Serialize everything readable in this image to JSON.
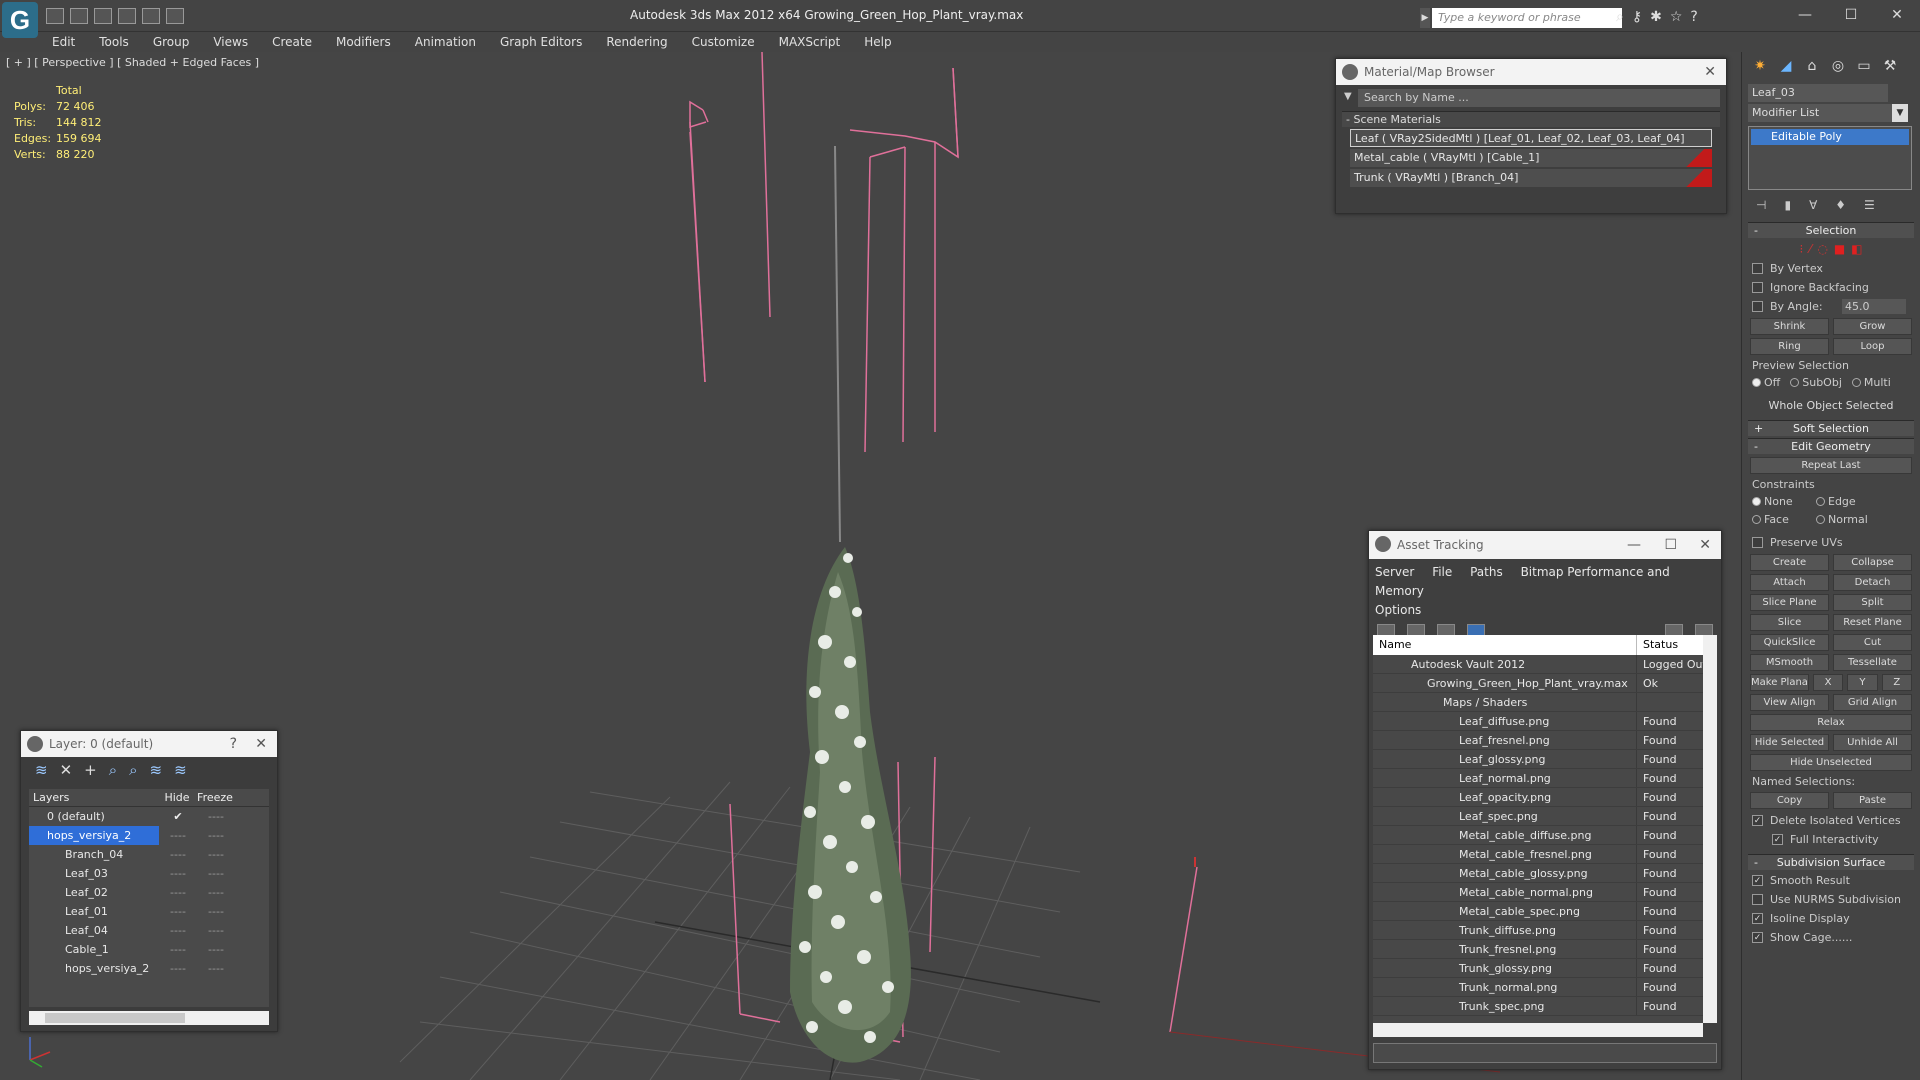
{
  "title_bar": {
    "window_title": "Autodesk 3ds Max  2012 x64       Growing_Green_Hop_Plant_vray.max",
    "search_placeholder": "Type a keyword or phrase",
    "minimize": "—",
    "maximize": "☐",
    "close": "✕"
  },
  "menu": [
    "Edit",
    "Tools",
    "Group",
    "Views",
    "Create",
    "Modifiers",
    "Animation",
    "Graph Editors",
    "Rendering",
    "Customize",
    "MAXScript",
    "Help"
  ],
  "viewport": {
    "label": "[ + ] [ Perspective ] [ Shaded + Edged Faces ]",
    "stats": {
      "header": "Total",
      "rows": [
        {
          "k": "Polys:",
          "v": "72 406"
        },
        {
          "k": "Tris:",
          "v": "144 812"
        },
        {
          "k": "Edges:",
          "v": "159 694"
        },
        {
          "k": "Verts:",
          "v": "88 220"
        }
      ]
    }
  },
  "material_browser": {
    "title": "Material/Map Browser",
    "search_placeholder": "Search by Name ...",
    "group": "- Scene Materials",
    "materials": [
      "Leaf  ( VRay2SidedMtl )  [Leaf_01, Leaf_02, Leaf_03, Leaf_04]",
      "Metal_cable  ( VRayMtl )  [Cable_1]",
      "Trunk  ( VRayMtl )  [Branch_04]"
    ]
  },
  "layers": {
    "title": "Layer: 0 (default)",
    "help": "?",
    "col_layers": "Layers",
    "col_hide": "Hide",
    "col_freeze": "Freeze",
    "rows": [
      {
        "name": "0 (default)",
        "hide": "✔",
        "freeze": "----"
      },
      {
        "name": "hops_versiya_2",
        "hide": "----",
        "freeze": "----"
      },
      {
        "name": "Branch_04",
        "hide": "----",
        "freeze": "----"
      },
      {
        "name": "Leaf_03",
        "hide": "----",
        "freeze": "----"
      },
      {
        "name": "Leaf_02",
        "hide": "----",
        "freeze": "----"
      },
      {
        "name": "Leaf_01",
        "hide": "----",
        "freeze": "----"
      },
      {
        "name": "Leaf_04",
        "hide": "----",
        "freeze": "----"
      },
      {
        "name": "Cable_1",
        "hide": "----",
        "freeze": "----"
      },
      {
        "name": "hops_versiya_2",
        "hide": "----",
        "freeze": "----"
      }
    ]
  },
  "asset_tracking": {
    "title": "Asset Tracking",
    "menu": [
      "Server",
      "File",
      "Paths",
      "Bitmap Performance and Memory",
      "Options"
    ],
    "col_name": "Name",
    "col_status": "Status",
    "rows": [
      {
        "name": "Autodesk Vault 2012",
        "status": "Logged Out"
      },
      {
        "name": "Growing_Green_Hop_Plant_vray.max",
        "status": "Ok"
      },
      {
        "name": "Maps / Shaders",
        "status": ""
      },
      {
        "name": "Leaf_diffuse.png",
        "status": "Found"
      },
      {
        "name": "Leaf_fresnel.png",
        "status": "Found"
      },
      {
        "name": "Leaf_glossy.png",
        "status": "Found"
      },
      {
        "name": "Leaf_normal.png",
        "status": "Found"
      },
      {
        "name": "Leaf_opacity.png",
        "status": "Found"
      },
      {
        "name": "Leaf_spec.png",
        "status": "Found"
      },
      {
        "name": "Metal_cable_diffuse.png",
        "status": "Found"
      },
      {
        "name": "Metal_cable_fresnel.png",
        "status": "Found"
      },
      {
        "name": "Metal_cable_glossy.png",
        "status": "Found"
      },
      {
        "name": "Metal_cable_normal.png",
        "status": "Found"
      },
      {
        "name": "Metal_cable_spec.png",
        "status": "Found"
      },
      {
        "name": "Trunk_diffuse.png",
        "status": "Found"
      },
      {
        "name": "Trunk_fresnel.png",
        "status": "Found"
      },
      {
        "name": "Trunk_glossy.png",
        "status": "Found"
      },
      {
        "name": "Trunk_normal.png",
        "status": "Found"
      },
      {
        "name": "Trunk_spec.png",
        "status": "Found"
      }
    ]
  },
  "command_panel": {
    "object_name": "Leaf_03",
    "modifier_list": "Modifier List",
    "stack_item": "Editable Poly",
    "selection": {
      "title": "Selection",
      "by_vertex": "By Vertex",
      "ignore_backfacing": "Ignore Backfacing",
      "by_angle": "By Angle:",
      "angle_value": "45.0",
      "shrink": "Shrink",
      "grow": "Grow",
      "ring": "Ring",
      "loop": "Loop",
      "preview_selection": "Preview Selection",
      "off": "Off",
      "subobj": "SubObj",
      "multi": "Multi",
      "status": "Whole Object Selected"
    },
    "soft_selection": "Soft Selection",
    "edit_geometry": {
      "title": "Edit Geometry",
      "repeat_last": "Repeat Last",
      "constraints": "Constraints",
      "none": "None",
      "edge": "Edge",
      "face": "Face",
      "normal": "Normal",
      "preserve_uvs": "Preserve UVs",
      "create": "Create",
      "collapse": "Collapse",
      "attach": "Attach",
      "detach": "Detach",
      "slice_plane": "Slice Plane",
      "split": "Split",
      "slice": "Slice",
      "reset_plane": "Reset Plane",
      "quickslice": "QuickSlice",
      "cut": "Cut",
      "msmooth": "MSmooth",
      "tessellate": "Tessellate",
      "make_planar": "Make Planar",
      "x": "X",
      "y": "Y",
      "z": "Z",
      "view_align": "View Align",
      "grid_align": "Grid Align",
      "relax": "Relax",
      "hide_selected": "Hide Selected",
      "unhide_all": "Unhide All",
      "hide_unselected": "Hide Unselected",
      "named_selections": "Named Selections:",
      "copy": "Copy",
      "paste": "Paste",
      "delete_isolated": "Delete Isolated Vertices",
      "full_interactivity": "Full Interactivity"
    },
    "subdivision": {
      "title": "Subdivision Surface",
      "smooth_result": "Smooth Result",
      "use_nurms": "Use NURMS Subdivision",
      "isoline": "Isoline Display",
      "show_cage": "Show Cage......"
    }
  },
  "colors": {
    "accent_blue": "#3d79c9",
    "cage_pink": "#e0709a",
    "stats_yellow": "#ffee77",
    "material_red": "#c21a1a"
  }
}
